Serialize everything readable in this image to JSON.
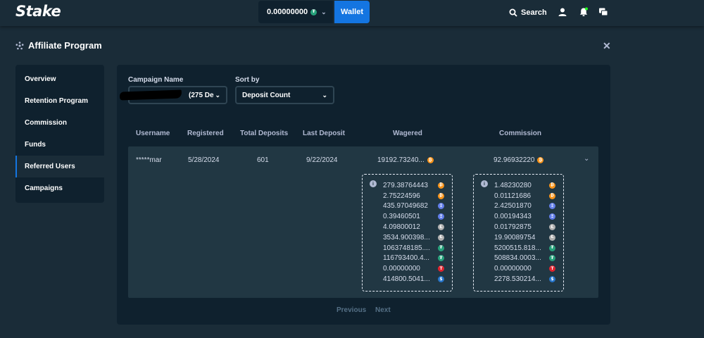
{
  "header": {
    "logo": "Stake",
    "balance": "0.00000000",
    "wallet_label": "Wallet",
    "search_label": "Search"
  },
  "panel": {
    "title": "Affiliate Program"
  },
  "sidebar": {
    "items": [
      {
        "label": "Overview"
      },
      {
        "label": "Retention Program"
      },
      {
        "label": "Commission"
      },
      {
        "label": "Funds"
      },
      {
        "label": "Referred Users"
      },
      {
        "label": "Campaigns"
      }
    ],
    "active_index": 4
  },
  "filters": {
    "campaign_label": "Campaign Name",
    "campaign_value": "(275 De",
    "sort_label": "Sort by",
    "sort_value": "Deposit Count"
  },
  "table": {
    "headers": [
      "Username",
      "Registered",
      "Total Deposits",
      "Last Deposit",
      "Wagered",
      "Commission"
    ],
    "row": {
      "username": "*****mar",
      "registered": "5/28/2024",
      "total_deposits": "601",
      "last_deposit": "9/22/2024",
      "wagered": "19192.73240...",
      "commission": "92.96932220"
    }
  },
  "wagered_breakdown": [
    {
      "value": "279.38764443",
      "coin": "btc"
    },
    {
      "value": "2.75224596",
      "coin": "btc"
    },
    {
      "value": "435.97049682",
      "coin": "eth"
    },
    {
      "value": "0.39460501",
      "coin": "eth"
    },
    {
      "value": "4.09800012",
      "coin": "ltc"
    },
    {
      "value": "3534.900398...",
      "coin": "ltc"
    },
    {
      "value": "1063748185....",
      "coin": "usdt"
    },
    {
      "value": "116793400.4...",
      "coin": "usdt"
    },
    {
      "value": "0.00000000",
      "coin": "trx"
    },
    {
      "value": "414800.5041...",
      "coin": "usdc"
    }
  ],
  "commission_breakdown": [
    {
      "value": "1.48230280",
      "coin": "btc"
    },
    {
      "value": "0.01121686",
      "coin": "btc"
    },
    {
      "value": "2.42501870",
      "coin": "eth"
    },
    {
      "value": "0.00194343",
      "coin": "eth"
    },
    {
      "value": "0.01792875",
      "coin": "ltc"
    },
    {
      "value": "19.90089754",
      "coin": "ltc"
    },
    {
      "value": "5200515.818...",
      "coin": "usdt"
    },
    {
      "value": "508834.0003...",
      "coin": "usdt"
    },
    {
      "value": "0.00000000",
      "coin": "trx"
    },
    {
      "value": "2278.530214...",
      "coin": "usdc"
    }
  ],
  "pagination": {
    "previous": "Previous",
    "next": "Next"
  },
  "colors": {
    "bg": "#1a2c38",
    "panel": "#0f212e",
    "row": "#213743",
    "accent": "#1475e1",
    "btc": "#f7931a",
    "eth": "#627eea",
    "ltc": "#b0b0b0",
    "usdt": "#26a17b",
    "trx": "#e0232e",
    "usdc": "#2775ca"
  }
}
